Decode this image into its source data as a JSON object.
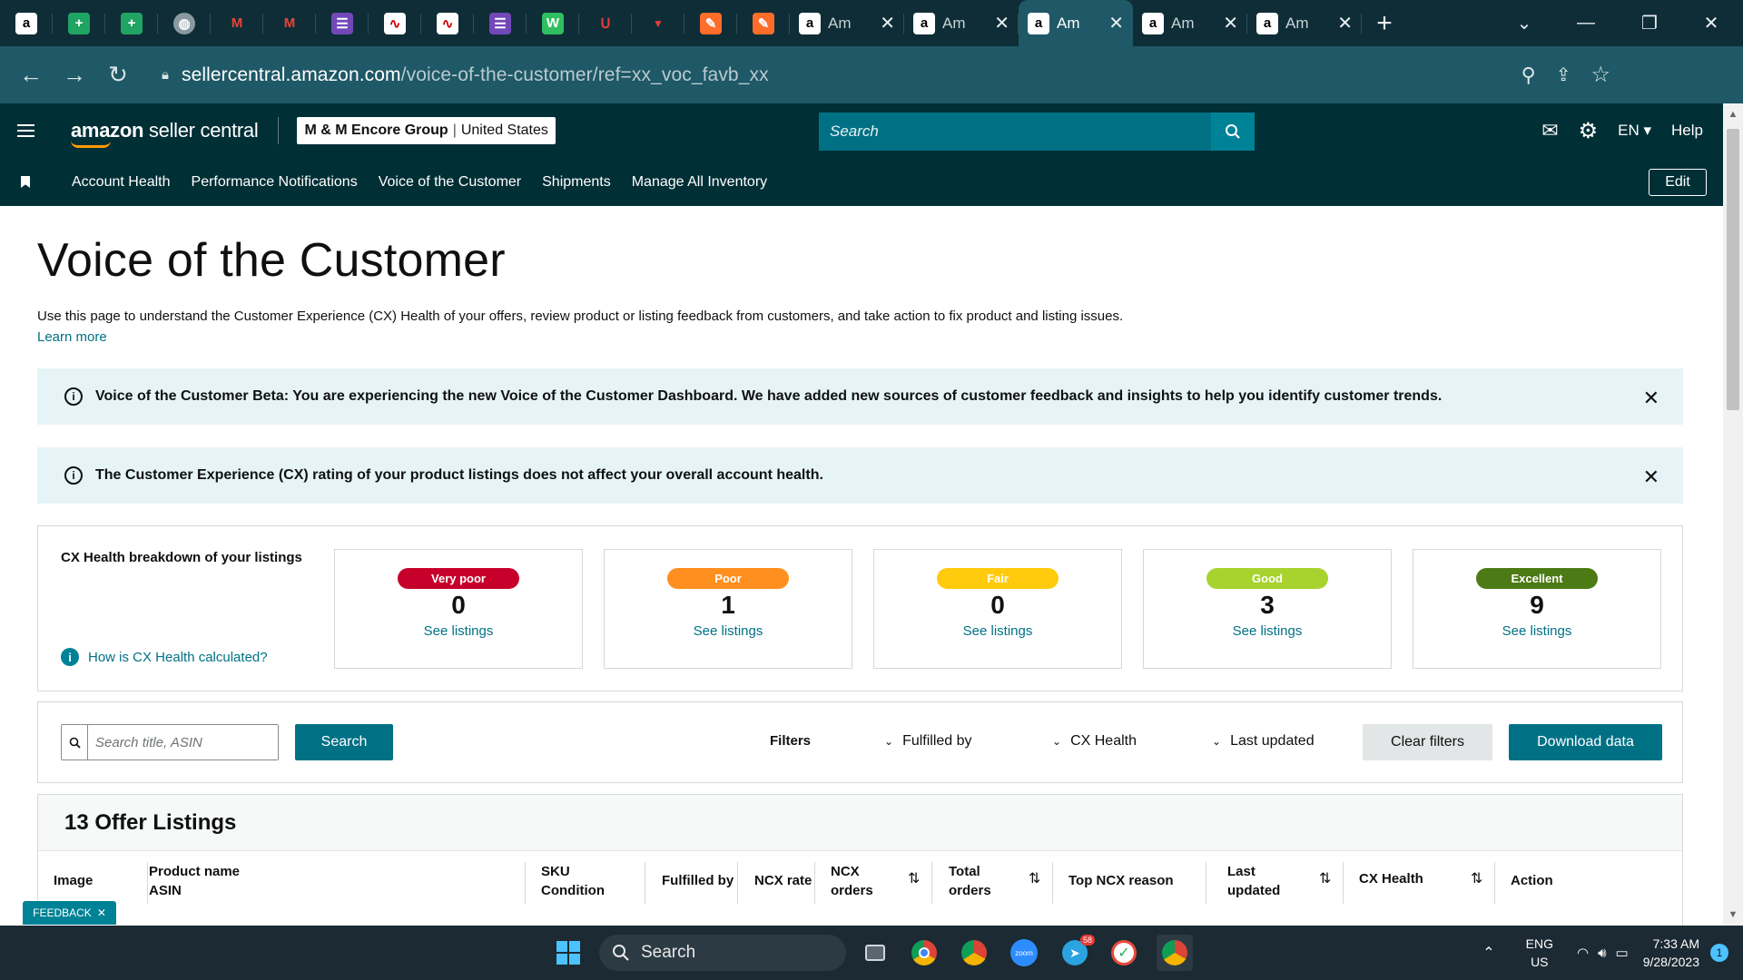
{
  "browser": {
    "tabs": [
      {
        "title": "Am"
      },
      {
        "title": "Am"
      },
      {
        "title": "Am"
      },
      {
        "title": "Am"
      },
      {
        "title": "Am"
      }
    ],
    "url_host": "sellercentral.amazon.com",
    "url_path": "/voice-of-the-customer/ref=xx_voc_favb_xx"
  },
  "header": {
    "logo_brand": "amazon",
    "logo_suffix": " seller central",
    "account_name": "M & M Encore Group",
    "account_region": "United States",
    "search_placeholder": "Search",
    "language": "EN",
    "help": "Help"
  },
  "nav": {
    "items": [
      "Account Health",
      "Performance Notifications",
      "Voice of the Customer",
      "Shipments",
      "Manage All Inventory"
    ],
    "edit": "Edit"
  },
  "page": {
    "title": "Voice of the Customer",
    "description": "Use this page to understand the Customer Experience (CX) Health of your offers, review product or listing feedback from customers, and take action to fix product and listing issues.",
    "learn_more": "Learn more",
    "alerts": [
      "Voice of the Customer Beta: You are experiencing the new Voice of the Customer Dashboard. We have added new sources of customer feedback and insights to help you identify customer trends.",
      "The Customer Experience (CX) rating of your product listings does not affect your overall account health."
    ]
  },
  "cx_health": {
    "title": "CX Health breakdown of your listings",
    "how_link": "How is CX Health calculated?",
    "cards": [
      {
        "label": "Very poor",
        "count": "0",
        "link": "See listings",
        "color": "#c7002b",
        "text": "#ffffff"
      },
      {
        "label": "Poor",
        "count": "1",
        "link": "See listings",
        "color": "#ff8f1f",
        "text": "#ffffff"
      },
      {
        "label": "Fair",
        "count": "0",
        "link": "See listings",
        "color": "#ffcb0c",
        "text": "#ffffff"
      },
      {
        "label": "Good",
        "count": "3",
        "link": "See listings",
        "color": "#a8d22e",
        "text": "#ffffff"
      },
      {
        "label": "Excellent",
        "count": "9",
        "link": "See listings",
        "color": "#4c7a14",
        "text": "#ffffff"
      }
    ]
  },
  "filters": {
    "search_placeholder": "Search title, ASIN",
    "search_button": "Search",
    "label": "Filters",
    "dropdowns": [
      "Fulfilled by",
      "CX Health",
      "Last updated"
    ],
    "clear": "Clear filters",
    "download": "Download data"
  },
  "listings": {
    "heading": "13 Offer Listings",
    "columns": [
      {
        "line1": "Image",
        "line2": ""
      },
      {
        "line1": "Product name",
        "line2": "ASIN"
      },
      {
        "line1": "SKU",
        "line2": "Condition"
      },
      {
        "line1": "Fulfilled by",
        "line2": ""
      },
      {
        "line1": "NCX rate",
        "line2": ""
      },
      {
        "line1": "NCX",
        "line2": "orders"
      },
      {
        "line1": "Total",
        "line2": "orders"
      },
      {
        "line1": "Top NCX reason",
        "line2": ""
      },
      {
        "line1": "Last",
        "line2": "updated"
      },
      {
        "line1": "CX Health",
        "line2": ""
      },
      {
        "line1": "Action",
        "line2": ""
      }
    ]
  },
  "feedback_tab": "FEEDBACK",
  "taskbar": {
    "search": "Search",
    "telegram_badge": "58",
    "lang_line1": "ENG",
    "lang_line2": "US",
    "time": "7:33 AM",
    "date": "9/28/2023",
    "notification_count": "1"
  }
}
